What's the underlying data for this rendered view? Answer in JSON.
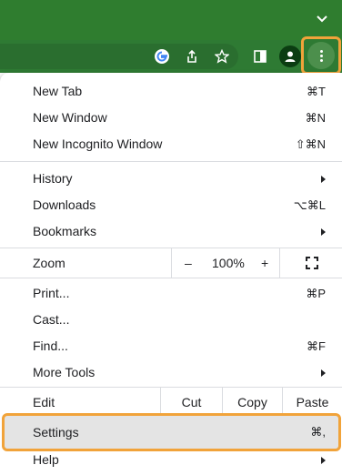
{
  "toolbar": {
    "icons": [
      "google-icon",
      "share-icon",
      "star-icon",
      "side-panel-icon",
      "profile-icon",
      "more-menu-icon"
    ],
    "colors": {
      "frame": "#2f7d2f",
      "highlight": "#f1a33a"
    }
  },
  "menu": {
    "group1": [
      {
        "label": "New Tab",
        "shortcut": "⌘T"
      },
      {
        "label": "New Window",
        "shortcut": "⌘N"
      },
      {
        "label": "New Incognito Window",
        "shortcut": "⇧⌘N"
      }
    ],
    "group2": [
      {
        "label": "History"
      },
      {
        "label": "Downloads",
        "shortcut": "⌥⌘L"
      },
      {
        "label": "Bookmarks"
      }
    ],
    "zoom": {
      "label": "Zoom",
      "minus": "–",
      "value": "100%",
      "plus": "+"
    },
    "group3": [
      {
        "label": "Print...",
        "shortcut": "⌘P"
      },
      {
        "label": "Cast..."
      },
      {
        "label": "Find...",
        "shortcut": "⌘F"
      },
      {
        "label": "More Tools"
      }
    ],
    "edit": {
      "label": "Edit",
      "cut": "Cut",
      "copy": "Copy",
      "paste": "Paste"
    },
    "settings": {
      "label": "Settings",
      "shortcut": "⌘,"
    },
    "help": {
      "label": "Help"
    }
  }
}
